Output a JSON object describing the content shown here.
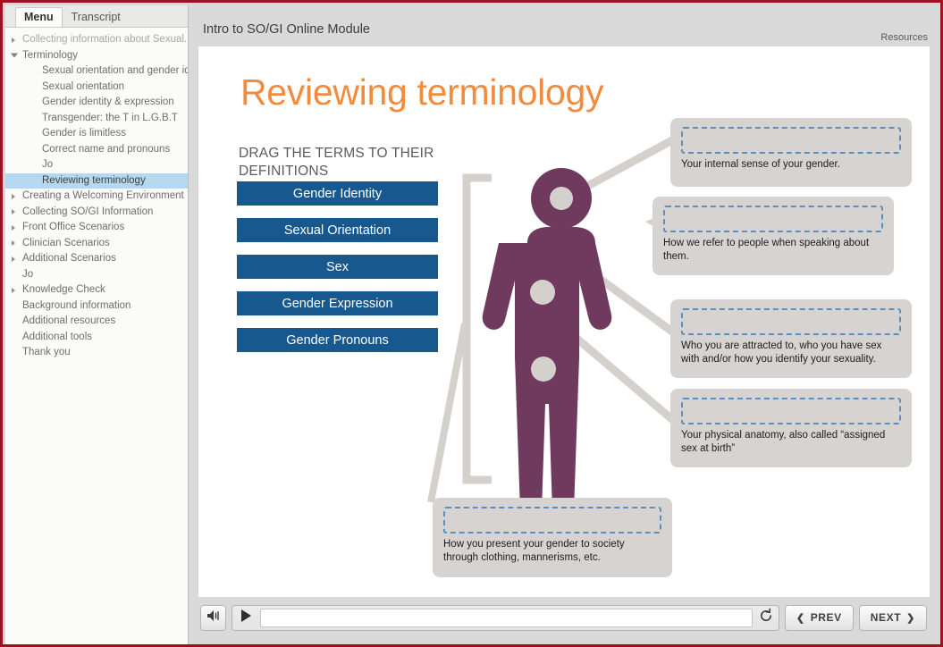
{
  "window": {
    "accent_red": "#a01020",
    "bg": "#d9d9d9"
  },
  "sidebar": {
    "tabs": [
      {
        "label": "Menu",
        "active": true
      },
      {
        "label": "Transcript",
        "active": false
      }
    ],
    "items": [
      {
        "label": "Collecting information about Sexual...",
        "level": 0,
        "caret": "collapsed",
        "dim": true,
        "selected": false
      },
      {
        "label": "Terminology",
        "level": 0,
        "caret": "expanded",
        "dim": false,
        "selected": false
      },
      {
        "label": "Sexual orientation and gender id...",
        "level": 1,
        "caret": "none",
        "dim": false,
        "selected": false
      },
      {
        "label": "Sexual orientation",
        "level": 1,
        "caret": "none",
        "dim": false,
        "selected": false
      },
      {
        "label": "Gender identity & expression",
        "level": 1,
        "caret": "none",
        "dim": false,
        "selected": false
      },
      {
        "label": "Transgender: the T in L.G.B.T",
        "level": 1,
        "caret": "none",
        "dim": false,
        "selected": false
      },
      {
        "label": "Gender is limitless",
        "level": 1,
        "caret": "none",
        "dim": false,
        "selected": false
      },
      {
        "label": "Correct name and pronouns",
        "level": 1,
        "caret": "none",
        "dim": false,
        "selected": false
      },
      {
        "label": "Jo",
        "level": 1,
        "caret": "none",
        "dim": false,
        "selected": false
      },
      {
        "label": "Reviewing terminology",
        "level": 1,
        "caret": "none",
        "dim": false,
        "selected": true
      },
      {
        "label": "Creating a Welcoming Environment",
        "level": 0,
        "caret": "collapsed",
        "dim": false,
        "selected": false
      },
      {
        "label": "Collecting SO/GI Information",
        "level": 0,
        "caret": "collapsed",
        "dim": false,
        "selected": false
      },
      {
        "label": "Front Office Scenarios",
        "level": 0,
        "caret": "collapsed",
        "dim": false,
        "selected": false
      },
      {
        "label": "Clinician Scenarios",
        "level": 0,
        "caret": "collapsed",
        "dim": false,
        "selected": false
      },
      {
        "label": "Additional Scenarios",
        "level": 0,
        "caret": "collapsed",
        "dim": false,
        "selected": false
      },
      {
        "label": "Jo",
        "level": 0,
        "caret": "none",
        "dim": false,
        "selected": false
      },
      {
        "label": "Knowledge Check",
        "level": 0,
        "caret": "collapsed",
        "dim": false,
        "selected": false
      },
      {
        "label": "Background information",
        "level": 0,
        "caret": "none",
        "dim": false,
        "selected": false
      },
      {
        "label": "Additional resources",
        "level": 0,
        "caret": "none",
        "dim": false,
        "selected": false
      },
      {
        "label": "Additional tools",
        "level": 0,
        "caret": "none",
        "dim": false,
        "selected": false
      },
      {
        "label": "Thank you",
        "level": 0,
        "caret": "none",
        "dim": false,
        "selected": false
      }
    ]
  },
  "header": {
    "module_title": "Intro to SO/GI Online Module",
    "resources_label": "Resources"
  },
  "slide": {
    "title": "Reviewing terminology",
    "title_color": "#ef8c3f",
    "instruction": "DRAG THE TERMS TO THEIR DEFINITIONS",
    "term_color": "#17588f",
    "figure_color": "#70395e",
    "connector_color": "#d4d1cd",
    "drop_border_color": "#5b8fc0",
    "terms": [
      {
        "label": "Gender Identity"
      },
      {
        "label": "Sexual Orientation"
      },
      {
        "label": "Sex"
      },
      {
        "label": "Gender Expression"
      },
      {
        "label": "Gender Pronouns"
      }
    ],
    "definitions": [
      {
        "text": "Your internal sense of your gender."
      },
      {
        "text": "How we refer to people when speaking about them."
      },
      {
        "text": "Who you are attracted to, who you have sex with and/or how you identify your sexuality."
      },
      {
        "text": "Your physical anatomy, also called “assigned sex at birth”"
      },
      {
        "text": "How you present your gender to society through clothing, mannerisms, etc."
      }
    ]
  },
  "player": {
    "volume_icon": "speaker-icon",
    "play_icon": "play-icon",
    "replay_icon": "replay-icon",
    "prev_label": "PREV",
    "next_label": "NEXT",
    "prev_chevron": "❮",
    "next_chevron": "❯",
    "progress_percent": 0
  }
}
